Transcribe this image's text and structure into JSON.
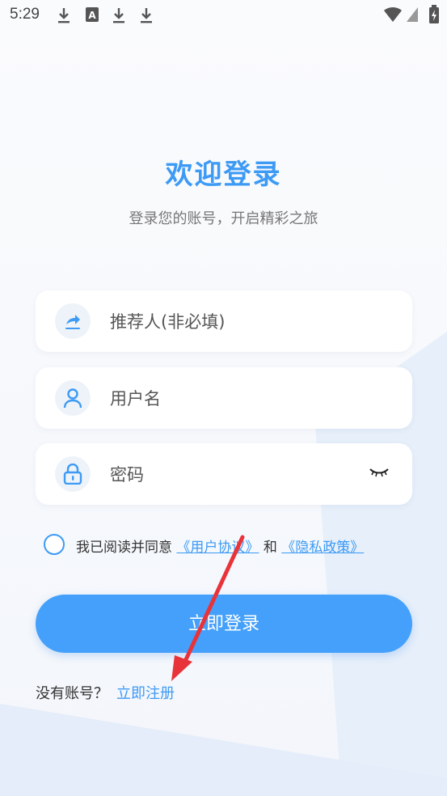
{
  "status_bar": {
    "time": "5:29",
    "icons": [
      "download-icon",
      "font-a-icon",
      "download-icon",
      "download-icon",
      "wifi-icon",
      "signal-icon",
      "battery-charging-icon"
    ]
  },
  "header": {
    "title": "欢迎登录",
    "subtitle": "登录您的账号，开启精彩之旅"
  },
  "form": {
    "referrer": {
      "placeholder": "推荐人(非必填)",
      "icon": "referral-share-icon"
    },
    "username": {
      "placeholder": "用户名",
      "icon": "user-icon"
    },
    "password": {
      "placeholder": "密码",
      "icon": "lock-icon",
      "toggle_icon": "eye-closed-icon"
    }
  },
  "agreement": {
    "prefix": "我已阅读并同意",
    "user_agreement": "《用户协议》",
    "and": "和",
    "privacy_policy": "《隐私政策》",
    "checked": false
  },
  "login_button": {
    "label": "立即登录"
  },
  "register": {
    "prompt": "没有账号？",
    "link": "立即注册"
  },
  "colors": {
    "accent": "#3d9af5",
    "button": "#44a0fa",
    "annotation_arrow": "#e8333a"
  }
}
